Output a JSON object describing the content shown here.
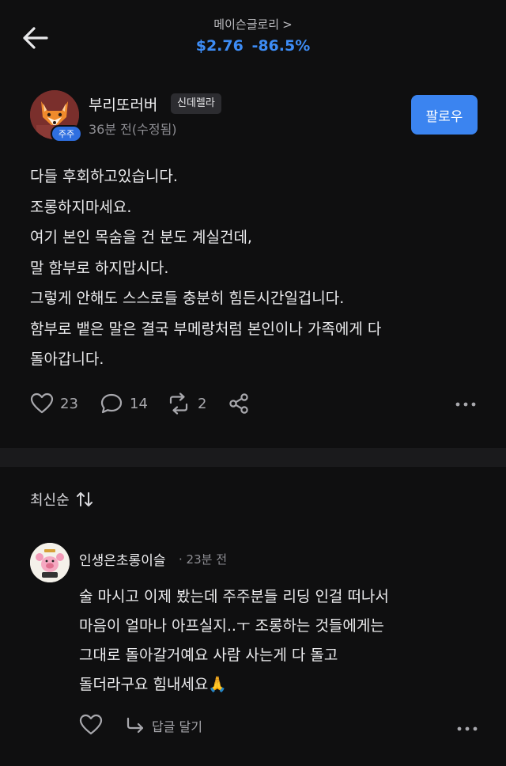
{
  "header": {
    "stock_name": "메이슨글로리",
    "chevron": ">",
    "price": "$2.76",
    "change": "-86.5%",
    "accent_color": "#3d8cf5"
  },
  "post": {
    "author": "부리또러버",
    "rank_badge": "신데렐라",
    "avatar_badge": "주주",
    "time": "36분 전(수정됨)",
    "follow_label": "팔로우",
    "lines": [
      "다들 후회하고있습니다.",
      "조롱하지마세요.",
      "여기 본인 목숨을 건 분도 계실건데,",
      "말 함부로 하지맙시다.",
      "그렇게 안해도 스스로들 충분히 힘든시간일겁니다.",
      "함부로 뱉은 말은 결국 부메랑처럼 본인이나 가족에게 다",
      "돌아갑니다."
    ],
    "likes": "23",
    "comments": "14",
    "reposts": "2"
  },
  "sort": {
    "label": "최신순"
  },
  "comment": {
    "author": "인생은초롱이슬",
    "time": "· 23분 전",
    "lines": [
      "술 마시고 이제 봤는데 주주분들 리딩 인걸 떠나서",
      "마음이 얼마나 아프실지..ㅜ 조롱하는 것들에게는",
      "그대로 돌아갈거예요 사람 사는게 다 돌고",
      "돌더라구요 힘내세요🙏"
    ],
    "reply_label": "답글 달기"
  }
}
